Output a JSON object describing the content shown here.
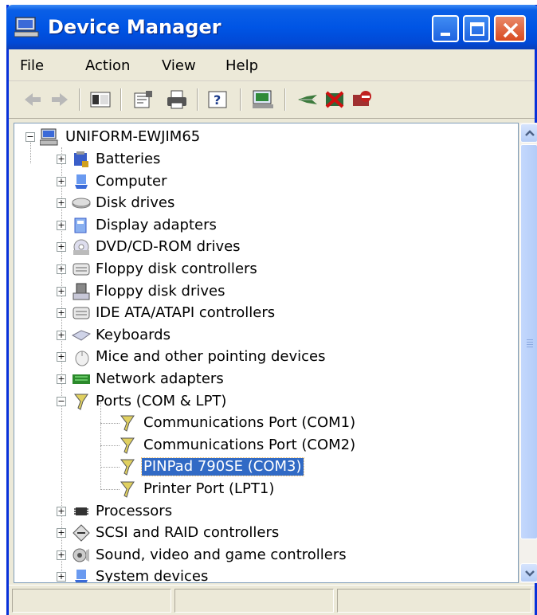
{
  "window": {
    "title": "Device Manager"
  },
  "menu": {
    "file": "File",
    "action": "Action",
    "view": "View",
    "help": "Help"
  },
  "toolbar": {
    "icons": [
      "back-arrow-icon",
      "forward-arrow-icon",
      "show-hide-console-tree-icon",
      "properties-icon",
      "print-icon",
      "help-icon",
      "scan-hardware-icon",
      "update-driver-icon",
      "uninstall-icon",
      "disable-icon"
    ]
  },
  "tree": {
    "root": "UNIFORM-EWJIM65",
    "categories": [
      {
        "label": "Batteries",
        "icon": "battery-icon"
      },
      {
        "label": "Computer",
        "icon": "computer-icon"
      },
      {
        "label": "Disk drives",
        "icon": "disk-drive-icon"
      },
      {
        "label": "Display adapters",
        "icon": "display-adapter-icon"
      },
      {
        "label": "DVD/CD-ROM drives",
        "icon": "cdrom-icon"
      },
      {
        "label": "Floppy disk controllers",
        "icon": "controller-icon"
      },
      {
        "label": "Floppy disk drives",
        "icon": "floppy-icon"
      },
      {
        "label": "IDE ATA/ATAPI controllers",
        "icon": "controller-icon"
      },
      {
        "label": "Keyboards",
        "icon": "keyboard-icon"
      },
      {
        "label": "Mice and other pointing devices",
        "icon": "mouse-icon"
      },
      {
        "label": "Network adapters",
        "icon": "network-adapter-icon"
      },
      {
        "label": "Ports (COM & LPT)",
        "icon": "port-icon",
        "expanded": true
      },
      {
        "label": "Processors",
        "icon": "processor-icon"
      },
      {
        "label": "SCSI and RAID controllers",
        "icon": "scsi-icon"
      },
      {
        "label": "Sound, video and game controllers",
        "icon": "sound-icon"
      },
      {
        "label": "System devices",
        "icon": "system-device-icon"
      }
    ],
    "ports": [
      {
        "label": "Communications Port (COM1)"
      },
      {
        "label": "Communications Port (COM2)"
      },
      {
        "label": "PINPad 790SE (COM3)",
        "selected": true
      },
      {
        "label": "Printer Port (LPT1)"
      }
    ]
  },
  "colors": {
    "titlebar": "#0055e5",
    "selection": "#316ac5",
    "close_button": "#d84a20"
  }
}
